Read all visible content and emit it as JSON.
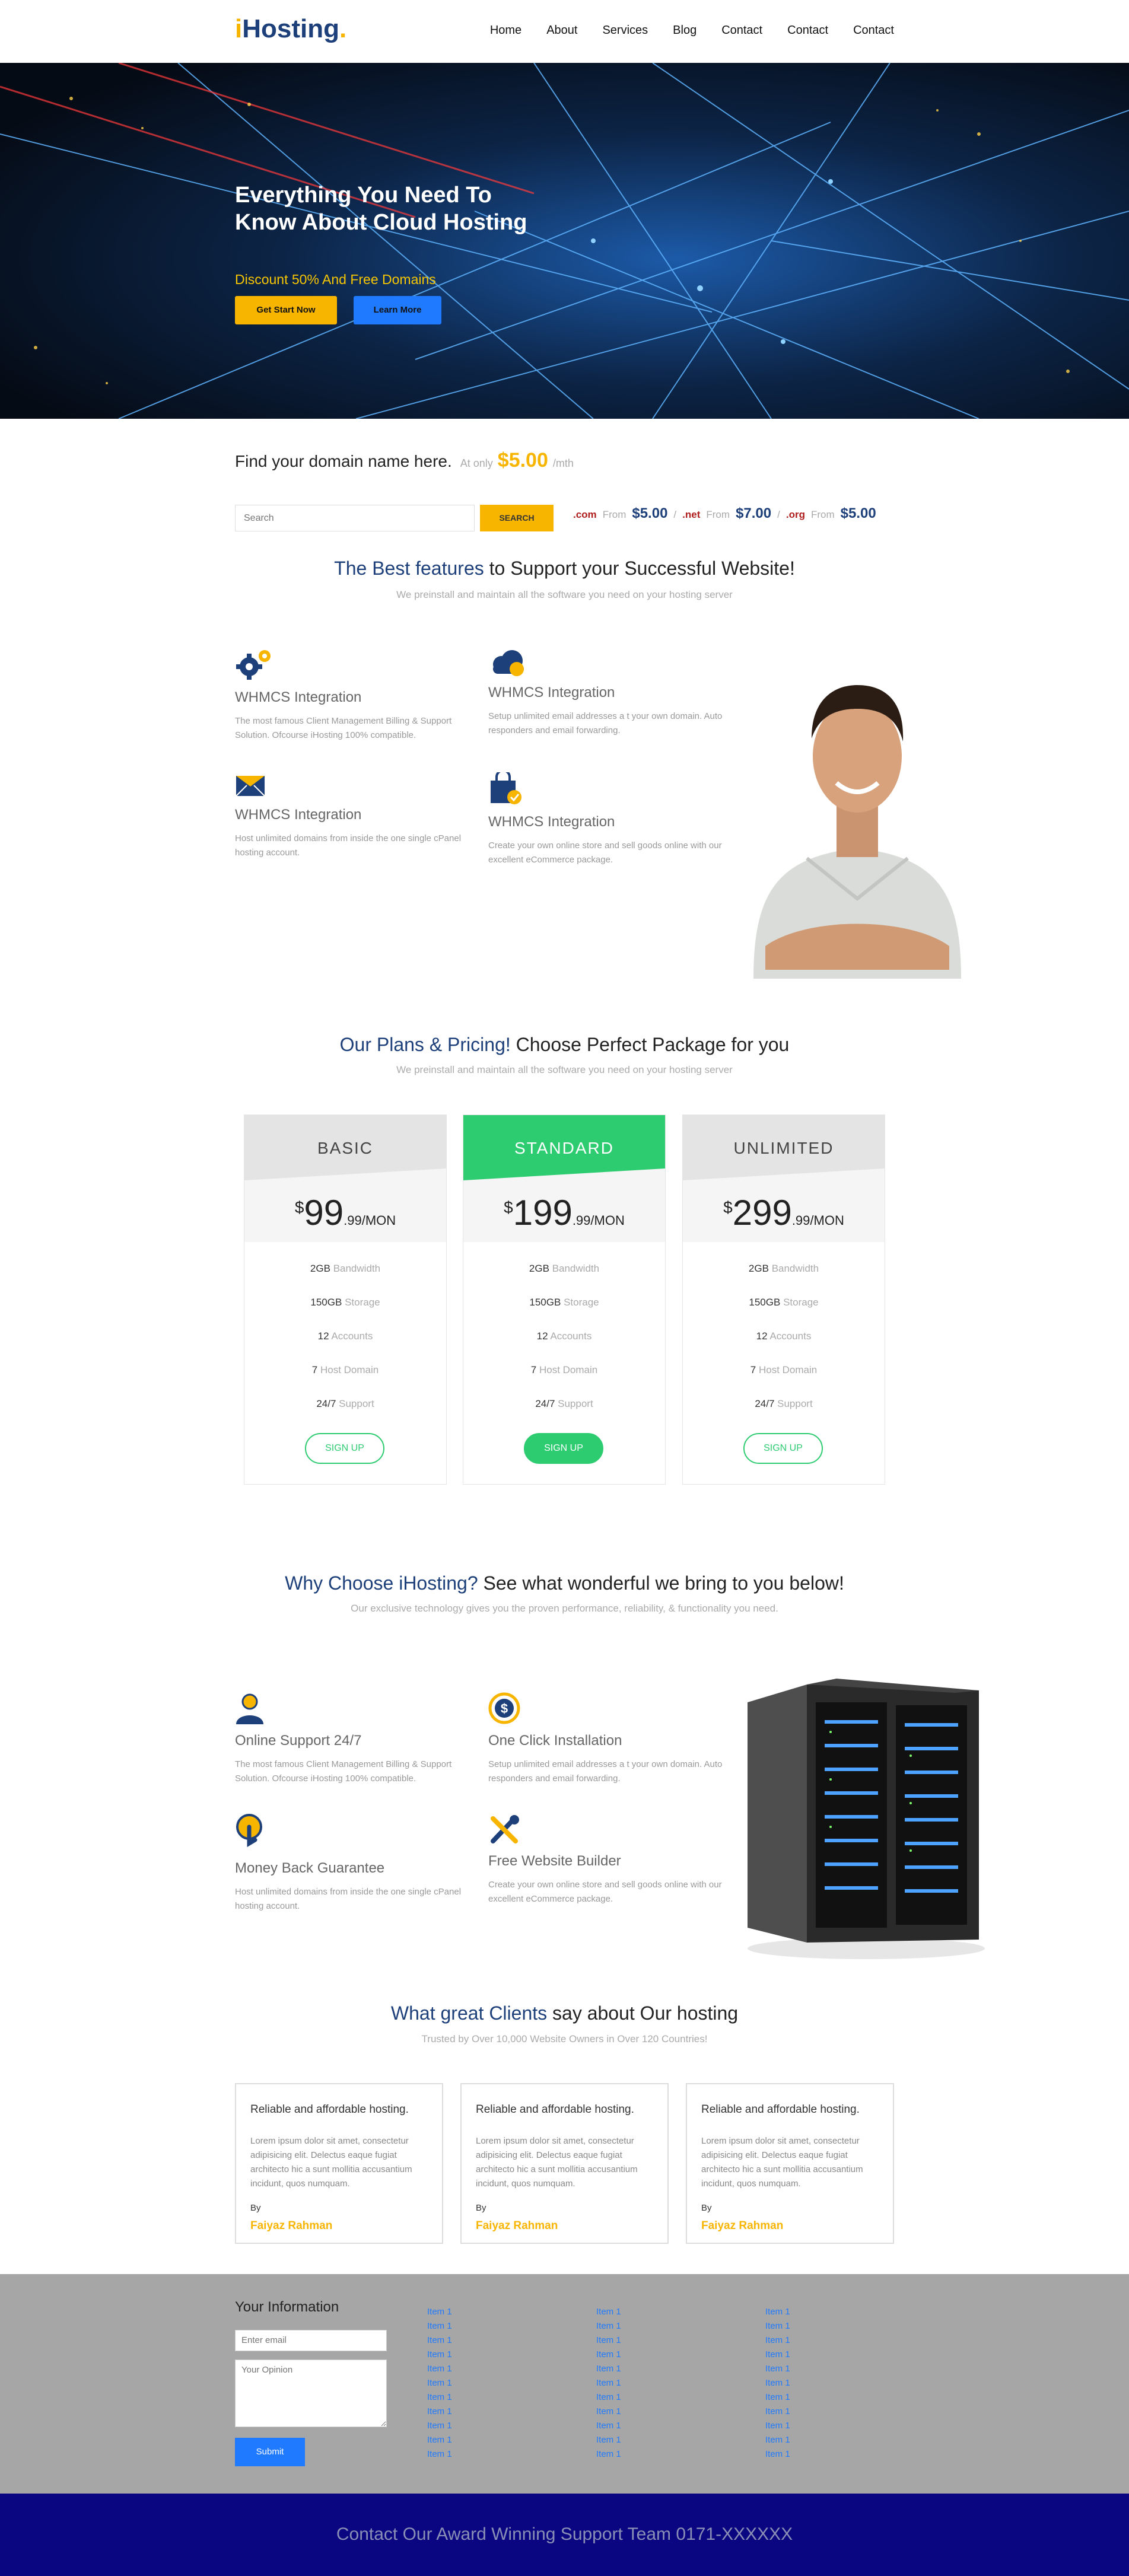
{
  "header": {
    "logo": {
      "i": "i",
      "main": "Hosting",
      "dot": "."
    },
    "nav": [
      "Home",
      "About",
      "Services",
      "Blog",
      "Contact",
      "Contact",
      "Contact"
    ]
  },
  "hero": {
    "title": "Everything You Need To Know About Cloud Hosting",
    "subtitle": "Discount 50% And Free Domains",
    "primary_button": "Get Start Now",
    "secondary_button": "Learn More"
  },
  "domain": {
    "heading": "Find your domain name here.",
    "at_only": "At only",
    "price": "$5.00",
    "per": "/mth",
    "search_placeholder": "Search",
    "search_button": "SEARCH",
    "tlds": [
      {
        "ext": ".com",
        "from": "From",
        "price": "$5.00",
        "sep": "/"
      },
      {
        "ext": ".net",
        "from": "From",
        "price": "$7.00",
        "sep": "/"
      },
      {
        "ext": ".org",
        "from": "From",
        "price": "$5.00",
        "sep": ""
      }
    ]
  },
  "features": {
    "heading_highlight": "The Best features",
    "heading_rest": "to Support your Successful Website!",
    "subheading": "We preinstall and maintain all the software you need on your hosting server",
    "items": [
      {
        "icon": "gears-icon",
        "title": "WHMCS Integration",
        "desc": "The most famous Client Management Billing & Support Solution. Ofcourse iHosting 100% compatible."
      },
      {
        "icon": "cloud-icon",
        "title": "WHMCS Integration",
        "desc": "Setup unlimited email addresses a t your own domain. Auto responders and email forwarding."
      },
      {
        "icon": "envelope-icon",
        "title": "WHMCS Integration",
        "desc": "Host unlimited domains from inside the one single cPanel hosting account."
      },
      {
        "icon": "shopping-bag-icon",
        "title": "WHMCS Integration",
        "desc": "Create your own online store and sell goods online with our excellent eCommerce package."
      }
    ]
  },
  "pricing": {
    "heading_highlight": "Our Plans & Pricing!",
    "heading_rest": "Choose Perfect Package for you",
    "subheading": "We preinstall and maintain all the software you need on your hosting server",
    "plans": [
      {
        "name": "BASIC",
        "currency": "$",
        "price": "99",
        "cents": ".99",
        "per": "/MON",
        "rows": [
          {
            "v": "2GB",
            "l": "Bandwidth"
          },
          {
            "v": "150GB",
            "l": "Storage"
          },
          {
            "v": "12",
            "l": "Accounts"
          },
          {
            "v": "7",
            "l": "Host Domain"
          },
          {
            "v": "24/7",
            "l": "Support"
          }
        ],
        "button": "SIGN UP"
      },
      {
        "name": "STANDARD",
        "currency": "$",
        "price": "199",
        "cents": ".99",
        "per": "/MON",
        "rows": [
          {
            "v": "2GB",
            "l": "Bandwidth"
          },
          {
            "v": "150GB",
            "l": "Storage"
          },
          {
            "v": "12",
            "l": "Accounts"
          },
          {
            "v": "7",
            "l": "Host Domain"
          },
          {
            "v": "24/7",
            "l": "Support"
          }
        ],
        "button": "SIGN UP"
      },
      {
        "name": "UNLIMITED",
        "currency": "$",
        "price": "299",
        "cents": ".99",
        "per": "/MON",
        "rows": [
          {
            "v": "2GB",
            "l": "Bandwidth"
          },
          {
            "v": "150GB",
            "l": "Storage"
          },
          {
            "v": "12",
            "l": "Accounts"
          },
          {
            "v": "7",
            "l": "Host Domain"
          },
          {
            "v": "24/7",
            "l": "Support"
          }
        ],
        "button": "SIGN UP"
      }
    ],
    "colors": {
      "accent": "#2ecc71",
      "head_gray": "#e8e8e8"
    }
  },
  "why": {
    "heading_highlight": "Why Choose iHosting?",
    "heading_rest": "See what wonderful we bring to you below!",
    "subheading": "Our exclusive technology gives you the proven performance, reliability, & functionality you need.",
    "items": [
      {
        "icon": "support-person-icon",
        "title": "Online Support 24/7",
        "desc": "The most famous Client Management Billing & Support Solution. Ofcourse iHosting 100% compatible."
      },
      {
        "icon": "dollar-coin-icon",
        "title": "One Click Installation",
        "desc": "Setup unlimited email addresses a t your own domain. Auto responders and email forwarding."
      },
      {
        "icon": "money-back-icon",
        "title": "Money Back Guarantee",
        "desc": "Host unlimited domains from inside the one single cPanel hosting account."
      },
      {
        "icon": "tools-icon",
        "title": "Free Website Builder",
        "desc": "Create your own online store and sell goods online with our excellent eCommerce package."
      }
    ]
  },
  "testimonials": {
    "heading_highlight": "What great Clients",
    "heading_rest": "say about Our hosting",
    "subheading": "Trusted by Over 10,000 Website Owners in Over 120 Countries!",
    "items": [
      {
        "title": "Reliable and affordable hosting.",
        "body": "Lorem ipsum dolor sit amet, consectetur adipisicing elit. Delectus eaque fugiat architecto hic a sunt mollitia accusantium incidunt, quos numquam.",
        "by": "By",
        "name": "Faiyaz Rahman"
      },
      {
        "title": "Reliable and affordable hosting.",
        "body": "Lorem ipsum dolor sit amet, consectetur adipisicing elit. Delectus eaque fugiat architecto hic a sunt mollitia accusantium incidunt, quos numquam.",
        "by": "By",
        "name": "Faiyaz Rahman"
      },
      {
        "title": "Reliable and affordable hosting.",
        "body": "Lorem ipsum dolor sit amet, consectetur adipisicing elit. Delectus eaque fugiat architecto hic a sunt mollitia accusantium incidunt, quos numquam.",
        "by": "By",
        "name": "Faiyaz Rahman"
      }
    ]
  },
  "footer": {
    "title": "Your Information",
    "email_placeholder": "Enter email",
    "opinion_placeholder": "Your Opinion",
    "submit": "Submit",
    "columns": [
      [
        "Item 1",
        "Item 1",
        "Item 1",
        "Item 1",
        "Item 1",
        "Item 1",
        "Item 1",
        "Item 1",
        "Item 1",
        "Item 1",
        "Item 1"
      ],
      [
        "Item 1",
        "Item 1",
        "Item 1",
        "Item 1",
        "Item 1",
        "Item 1",
        "Item 1",
        "Item 1",
        "Item 1",
        "Item 1",
        "Item 1"
      ],
      [
        "Item 1",
        "Item 1",
        "Item 1",
        "Item 1",
        "Item 1",
        "Item 1",
        "Item 1",
        "Item 1",
        "Item 1",
        "Item 1",
        "Item 1"
      ]
    ],
    "bottom_text": "Contact Our Award Winning Support Team 0171-XXXXXX"
  }
}
